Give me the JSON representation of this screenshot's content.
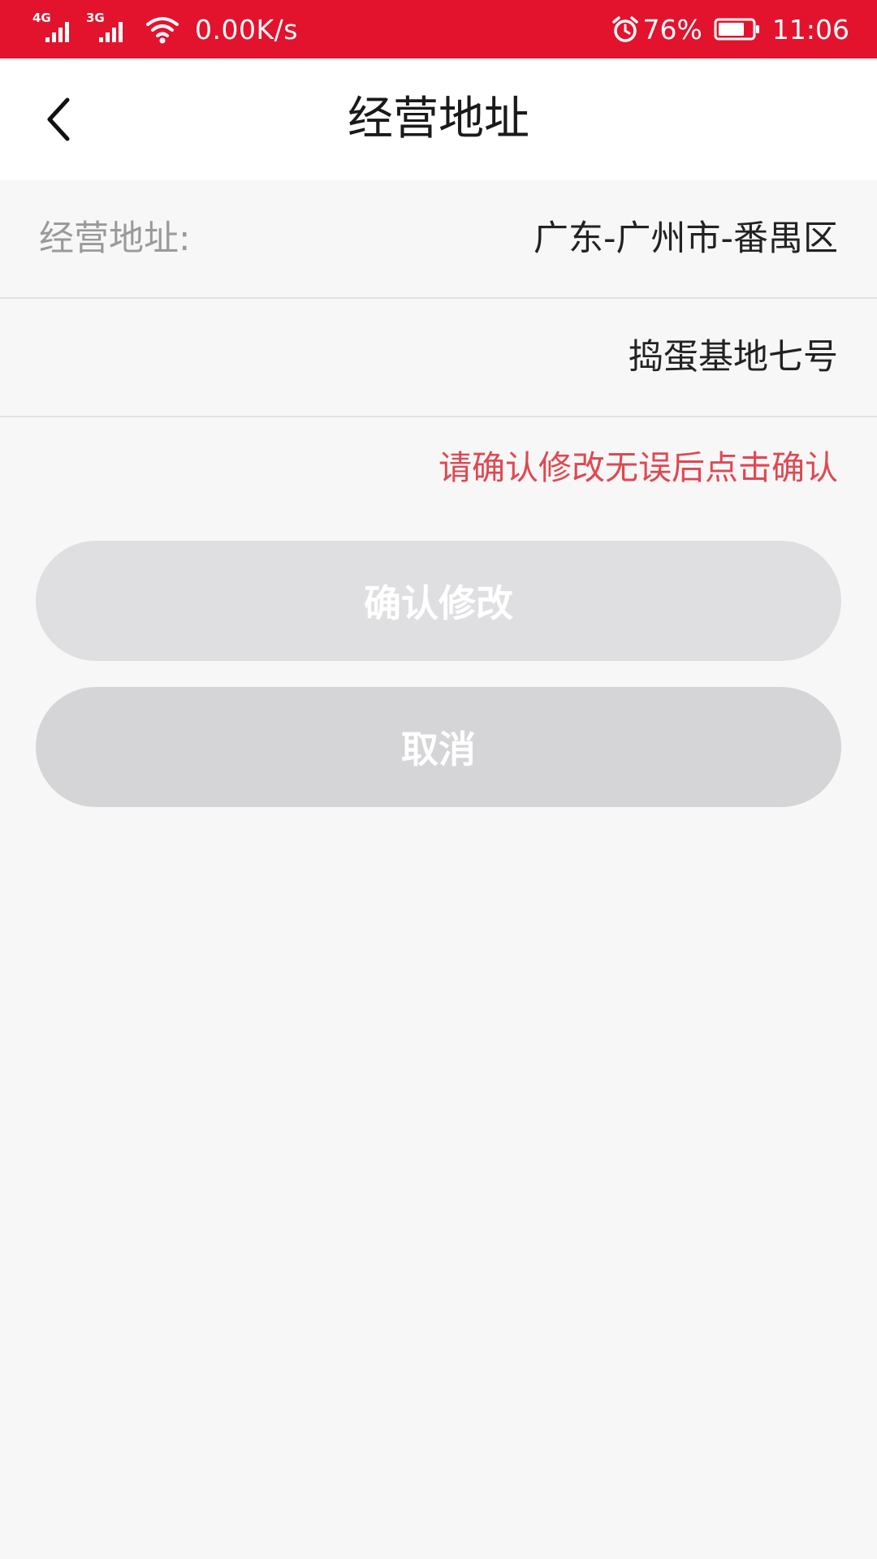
{
  "status_bar": {
    "network1": "4G",
    "network2": "3G",
    "speed": "0.00K/s",
    "battery_percent": "76%",
    "time": "11:06",
    "icons": [
      "signal-icon",
      "wifi-icon",
      "alarm-icon",
      "battery-icon"
    ],
    "background_color": "#e3132d"
  },
  "header": {
    "title": "经营地址",
    "back_icon": "chevron-left-icon"
  },
  "form": {
    "address_label": "经营地址:",
    "region_value": "广东-广州市-番禺区",
    "detail_value": "捣蛋基地七号"
  },
  "hint": {
    "text": "请确认修改无误后点击确认",
    "color": "#e04850"
  },
  "buttons": {
    "confirm_label": "确认修改",
    "cancel_label": "取消"
  }
}
